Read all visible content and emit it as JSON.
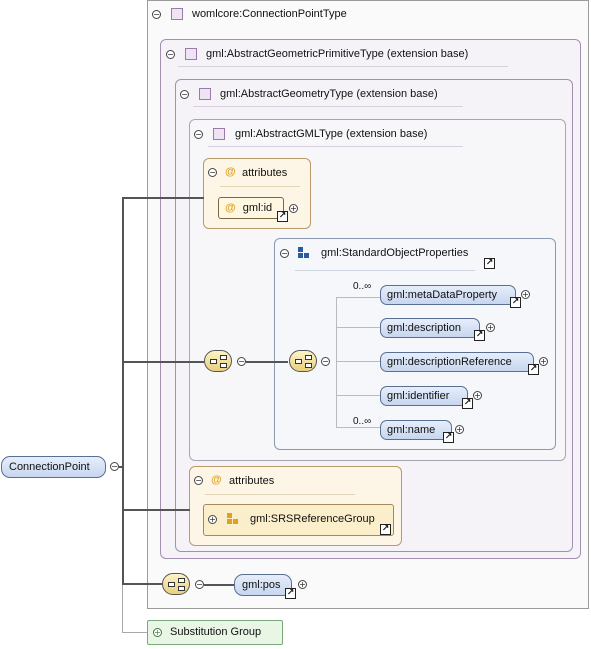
{
  "root_element": "ConnectionPoint",
  "complex_type": "womlcore:ConnectionPointType",
  "base_types": [
    "gml:AbstractGeometricPrimitiveType (extension base)",
    "gml:AbstractGeometryType (extension base)",
    "gml:AbstractGMLType (extension base)"
  ],
  "attributes_label": "attributes",
  "attribute_id": "gml:id",
  "group": {
    "name": "gml:StandardObjectProperties",
    "elements": [
      {
        "name": "gml:metaDataProperty",
        "occurs": "0..∞"
      },
      {
        "name": "gml:description",
        "occurs": ""
      },
      {
        "name": "gml:descriptionReference",
        "occurs": ""
      },
      {
        "name": "gml:identifier",
        "occurs": ""
      },
      {
        "name": "gml:name",
        "occurs": "0..∞"
      }
    ]
  },
  "attribute_group": "gml:SRSReferenceGroup",
  "pos_element": "gml:pos",
  "substitution_group": "Substitution Group",
  "colors": {
    "element_fill": "#c7d6ef",
    "attribute_fill": "#fdf6e6",
    "type_fill": "#f6f3f8",
    "substitution_fill": "#e9f6e6",
    "attribute_symbol": "#e0a020"
  }
}
